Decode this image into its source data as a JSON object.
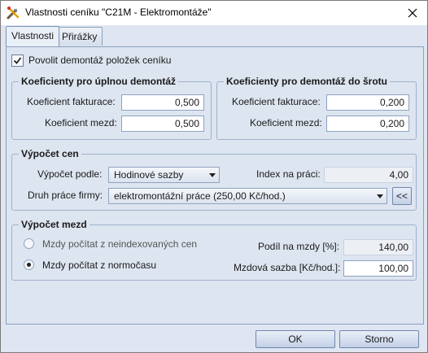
{
  "window": {
    "title": "Vlastnosti ceníku \"C21M - Elektromontáže\""
  },
  "tabs": [
    {
      "label": "Vlastnosti",
      "active": true
    },
    {
      "label": "Přirážky",
      "active": false
    }
  ],
  "allow_demolition": {
    "label": "Povolit demontáž položek ceníku",
    "checked": true
  },
  "full_demolition": {
    "title": "Koeficienty pro úplnou demontáž",
    "billing_label": "Koeficient fakturace:",
    "billing_value": "0,500",
    "wage_label": "Koeficient mezd:",
    "wage_value": "0,500"
  },
  "scrap_demolition": {
    "title": "Koeficienty pro demontáž do šrotu",
    "billing_label": "Koeficient fakturace:",
    "billing_value": "0,200",
    "wage_label": "Koeficient mezd:",
    "wage_value": "0,200"
  },
  "price_calc": {
    "title": "Výpočet cen",
    "calc_by_label": "Výpočet podle:",
    "calc_by_value": "Hodinové sazby",
    "work_index_label": "Index na práci:",
    "work_index_value": "4,00",
    "work_type_label": "Druh práce firmy:",
    "work_type_value": "elektromontážní práce (250,00 Kč/hod.)",
    "back_button": "<<"
  },
  "wage_calc": {
    "title": "Výpočet mezd",
    "option_nonindexed": {
      "label": "Mzdy počítat z neindexovaných cen",
      "selected": false
    },
    "option_standard": {
      "label": "Mzdy počítat z normočasu",
      "selected": true
    },
    "wage_share_label": "Podíl na mzdy [%]:",
    "wage_share_value": "140,00",
    "wage_rate_label": "Mzdová sazba [Kč/hod.]:",
    "wage_rate_value": "100,00"
  },
  "buttons": {
    "ok": "OK",
    "cancel": "Storno"
  }
}
